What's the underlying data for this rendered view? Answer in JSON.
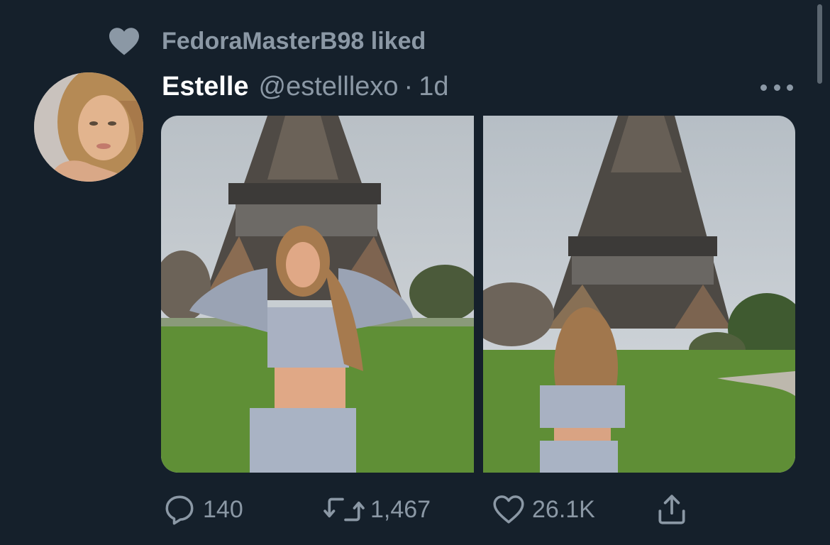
{
  "social_context": {
    "text": "FedoraMasterB98 liked",
    "icon": "heart-filled-icon"
  },
  "tweet": {
    "author_name": "Estelle",
    "handle": "@estelllexo",
    "separator": "·",
    "timestamp": "1d",
    "media_count": 2
  },
  "actions": {
    "reply_count": "140",
    "retweet_count": "1,467",
    "like_count": "26.1K"
  },
  "colors": {
    "background": "#15202b",
    "secondary_text": "#8b98a5",
    "primary_text": "#ffffff"
  }
}
